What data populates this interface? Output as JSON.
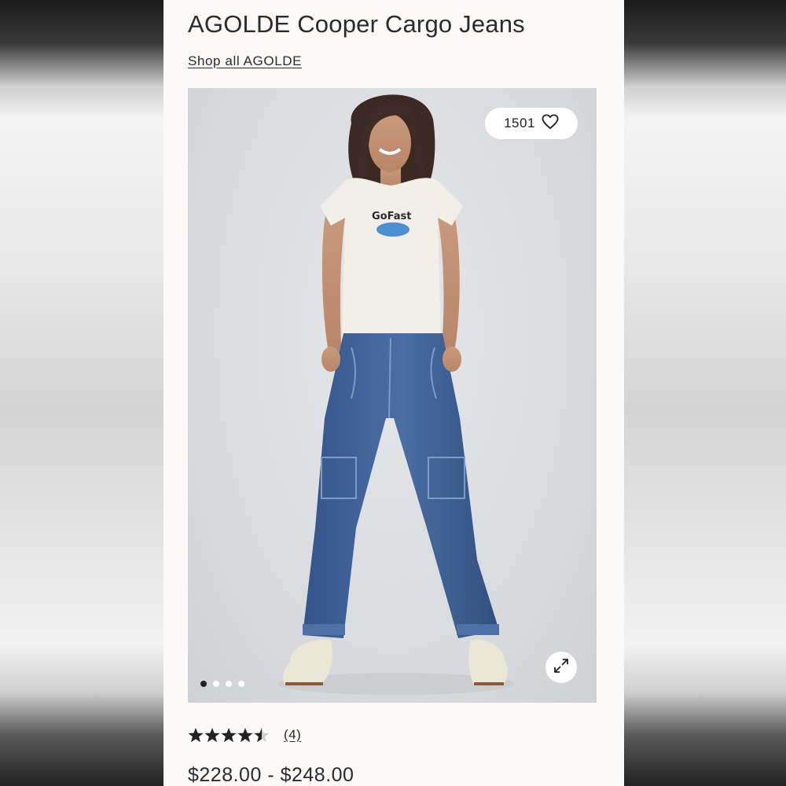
{
  "product": {
    "title": "AGOLDE Cooper Cargo Jeans",
    "shop_link": "Shop all AGOLDE",
    "favorites_count": "1501",
    "rating_value": 4.5,
    "rating_max": 5,
    "review_count": "(4)",
    "price": "$228.00 - $248.00"
  },
  "gallery": {
    "active_index": 0,
    "total_images": 4,
    "shirt_text": "GoFast"
  },
  "icons": {
    "favorite": "heart-outline-icon",
    "expand": "expand-arrows-icon",
    "rating": "star-icon"
  },
  "colors": {
    "panel_bg": "#fcfaf8",
    "text": "#2b2b2b",
    "denim": "#3d5f93"
  }
}
